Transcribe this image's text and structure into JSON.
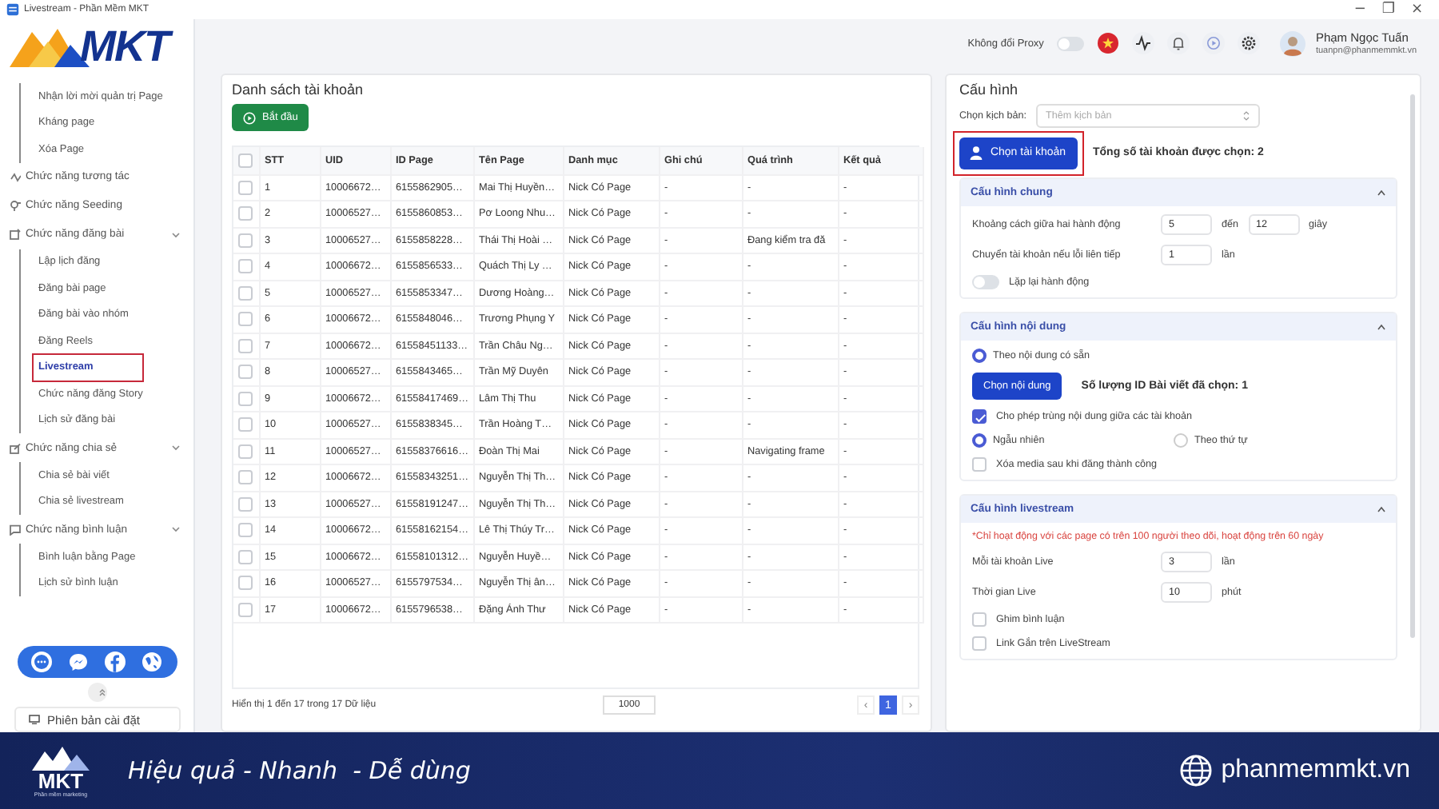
{
  "window": {
    "title": "Livestream - Phần Mềm MKT",
    "controls": [
      "−",
      "❐",
      "×"
    ]
  },
  "logo": {
    "text": "MKT"
  },
  "header": {
    "proxy": {
      "label": "Không đổi Proxy",
      "on": false
    },
    "user": {
      "name": "Phạm Ngọc Tuấn",
      "email": "tuanpn@phanmemmkt.vn"
    }
  },
  "sidebar": {
    "continued_items": [
      {
        "label": "Nhận lời mời quản trị Page",
        "selected": false
      },
      {
        "label": "Kháng page",
        "selected": false
      },
      {
        "label": "Xóa Page",
        "selected": false
      }
    ],
    "groups": [
      {
        "label": "Chức năng tương tác"
      },
      {
        "label": "Chức năng Seeding"
      },
      {
        "label": "Chức năng đăng bài",
        "expanded": true,
        "children": [
          {
            "label": "Lập lịch đăng",
            "selected": false
          },
          {
            "label": "Đăng bài page",
            "selected": false
          },
          {
            "label": "Đăng bài vào nhóm",
            "selected": false
          },
          {
            "label": "Đăng Reels",
            "selected": false
          },
          {
            "label": "Livestream",
            "selected": true,
            "highlighted": true
          },
          {
            "label": "Chức năng đăng Story",
            "selected": false
          },
          {
            "label": "Lịch sử đăng bài",
            "selected": false
          }
        ]
      },
      {
        "label": "Chức năng chia sẻ",
        "expanded": true,
        "children": [
          {
            "label": "Chia sẻ bài viết",
            "selected": false
          },
          {
            "label": "Chia sẻ livestream",
            "selected": false
          }
        ]
      },
      {
        "label": "Chức năng bình luận",
        "expanded": true,
        "children": [
          {
            "label": "Bình luận bằng Page",
            "selected": false
          },
          {
            "label": "Lịch sử bình luận",
            "selected": false
          }
        ]
      }
    ],
    "version_button": "Phiên bản cài đặt"
  },
  "accounts": {
    "title": "Danh sách tài khoản",
    "start_button": "Bắt đầu",
    "table": {
      "header_checked": false,
      "columns": [
        "STT",
        "UID",
        "ID Page",
        "Tên Page",
        "Danh mục",
        "Ghi chú",
        "Quá trình",
        "Kết quả"
      ],
      "rows": [
        {
          "checked": false,
          "cells": [
            "1",
            "10006672…",
            "6155862905…",
            "Mai Thị Huyền…",
            "Nick Có Page",
            "-",
            "-",
            "-"
          ]
        },
        {
          "checked": false,
          "cells": [
            "2",
            "10006527…",
            "6155860853…",
            "Pơ Loong Nhu…",
            "Nick Có Page",
            "-",
            "-",
            "-"
          ]
        },
        {
          "checked": false,
          "cells": [
            "3",
            "10006527…",
            "6155858228…",
            "Thái Thị Hoài …",
            "Nick Có Page",
            "-",
            "Đang kiểm tra đă",
            "-"
          ]
        },
        {
          "checked": false,
          "cells": [
            "4",
            "10006672…",
            "6155856533…",
            "Quách Thị Ly …",
            "Nick Có Page",
            "-",
            "-",
            "-"
          ]
        },
        {
          "checked": false,
          "cells": [
            "5",
            "10006527…",
            "6155853347…",
            "Dương Hoàng…",
            "Nick Có Page",
            "-",
            "-",
            "-"
          ]
        },
        {
          "checked": false,
          "cells": [
            "6",
            "10006672…",
            "6155848046…",
            "Trương Phụng Y",
            "Nick Có Page",
            "-",
            "-",
            "-"
          ]
        },
        {
          "checked": false,
          "cells": [
            "7",
            "10006672…",
            "61558451133…",
            "Trần Châu Ng…",
            "Nick Có Page",
            "-",
            "-",
            "-"
          ]
        },
        {
          "checked": false,
          "cells": [
            "8",
            "10006527…",
            "6155843465…",
            "Trần Mỹ Duyên",
            "Nick Có Page",
            "-",
            "-",
            "-"
          ]
        },
        {
          "checked": false,
          "cells": [
            "9",
            "10006672…",
            "61558417469…",
            "Lâm Thị Thu",
            "Nick Có Page",
            "-",
            "-",
            "-"
          ]
        },
        {
          "checked": false,
          "cells": [
            "10",
            "10006527…",
            "6155838345…",
            "Trần Hoàng T…",
            "Nick Có Page",
            "-",
            "-",
            "-"
          ]
        },
        {
          "checked": false,
          "cells": [
            "11",
            "10006527…",
            "61558376616…",
            "Đoàn Thị Mai",
            "Nick Có Page",
            "-",
            "Navigating frame",
            "-"
          ]
        },
        {
          "checked": false,
          "cells": [
            "12",
            "10006672…",
            "61558343251…",
            "Nguyễn Thị Th…",
            "Nick Có Page",
            "-",
            "-",
            "-"
          ]
        },
        {
          "checked": false,
          "cells": [
            "13",
            "10006527…",
            "61558191247…",
            "Nguyễn Thị Th…",
            "Nick Có Page",
            "-",
            "-",
            "-"
          ]
        },
        {
          "checked": false,
          "cells": [
            "14",
            "10006672…",
            "61558162154…",
            "Lê Thị Thúy Tr…",
            "Nick Có Page",
            "-",
            "-",
            "-"
          ]
        },
        {
          "checked": false,
          "cells": [
            "15",
            "10006672…",
            "61558101312…",
            "Nguyễn Huyề…",
            "Nick Có Page",
            "-",
            "-",
            "-"
          ]
        },
        {
          "checked": false,
          "cells": [
            "16",
            "10006527…",
            "6155797534…",
            "Nguyễn Thị ân…",
            "Nick Có Page",
            "-",
            "-",
            "-"
          ]
        },
        {
          "checked": false,
          "cells": [
            "17",
            "10006672…",
            "6155796538…",
            "Đặng Ánh Thư",
            "Nick Có Page",
            "-",
            "-",
            "-"
          ]
        }
      ]
    },
    "footer": {
      "summary": "Hiển thị 1 đến 17 trong 17 Dữ liệu",
      "page_size": "1000",
      "prev": "‹",
      "next": "›",
      "pages": [
        {
          "label": "1",
          "selected": true
        }
      ]
    }
  },
  "config": {
    "title": "Cấu hình",
    "script_label": "Chọn kịch bản:",
    "script_placeholder": "Thêm kịch bản",
    "choose_account": {
      "label": "Chọn tài khoản",
      "highlighted": true
    },
    "selected_count": "Tổng số tài khoản được chọn: 2",
    "sections": [
      {
        "title": "Cấu hình chung",
        "expanded": true,
        "rows": [
          {
            "kind": "inputs",
            "label": "Khoảng cách giữa hai hành động",
            "parts": [
              {
                "value": "5"
              },
              {
                "text": "đến"
              },
              {
                "value": "12"
              },
              {
                "text": "giây"
              }
            ]
          },
          {
            "kind": "inputs",
            "label": "Chuyển tài khoản nếu lỗi liên tiếp",
            "parts": [
              {
                "value": "1"
              },
              {
                "text": "lần"
              }
            ]
          },
          {
            "kind": "toggle",
            "label": "Lặp lại hành động",
            "on": false
          }
        ]
      },
      {
        "title": "Cấu hình nội dung",
        "expanded": true,
        "rows": [
          {
            "kind": "radios",
            "options": [
              {
                "label": "Theo nội dung có sẵn",
                "selected": true
              }
            ]
          },
          {
            "kind": "button",
            "label": "Chọn nội dung",
            "text": "Số lượng ID Bài viết đã chọn: 1"
          },
          {
            "kind": "checkbox",
            "label": "Cho phép trùng nội dung giữa các tài khoản",
            "checked": true
          },
          {
            "kind": "radios",
            "options": [
              {
                "label": "Ngẫu nhiên",
                "selected": true
              },
              {
                "label": "Theo thứ tự",
                "selected": false
              }
            ]
          },
          {
            "kind": "checkbox",
            "label": "Xóa media sau khi đăng thành công",
            "checked": false
          }
        ]
      },
      {
        "title": "Cấu hình livestream",
        "expanded": true,
        "rows": [
          {
            "kind": "warning",
            "text": "*Chỉ hoạt động với các page có trên 100 người theo dõi, hoạt động trên 60 ngày"
          },
          {
            "kind": "inputs",
            "label": "Mỗi tài khoản Live",
            "parts": [
              {
                "value": "3"
              },
              {
                "text": "lần"
              }
            ]
          },
          {
            "kind": "inputs",
            "label": "Thời gian Live",
            "parts": [
              {
                "value": "10"
              },
              {
                "text": "phút"
              }
            ]
          },
          {
            "kind": "checkbox",
            "label": "Ghim bình luận",
            "checked": false
          },
          {
            "kind": "checkbox",
            "label": "Link Gắn trên LiveStream",
            "checked": false
          }
        ]
      }
    ]
  },
  "banner": {
    "logo": "MKT",
    "tagline": "Phần mềm marketing",
    "slogan": "Hiệu quả - Nhanh  - Dễ dùng",
    "website": "phanmemmkt.vn"
  }
}
